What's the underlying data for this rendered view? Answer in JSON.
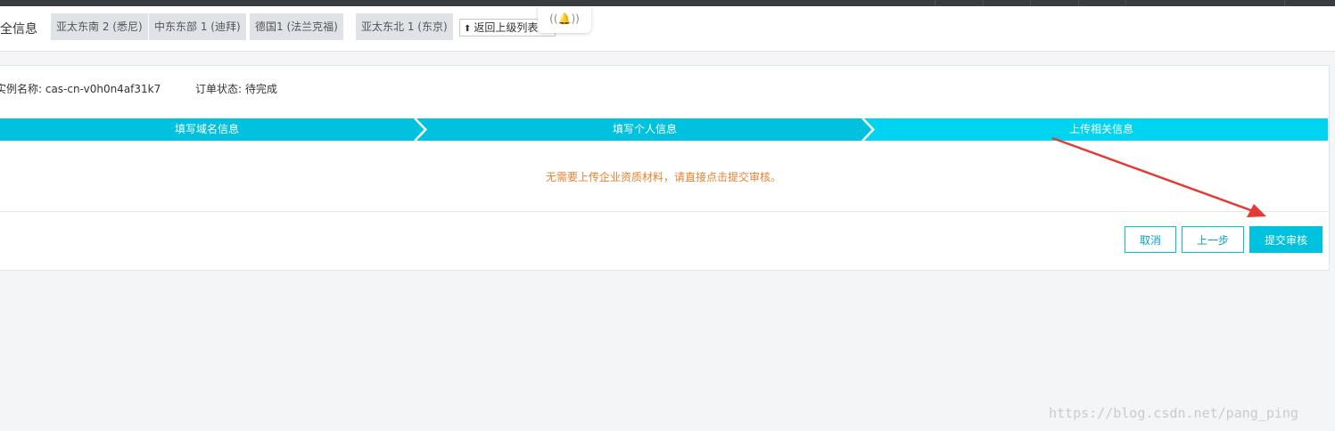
{
  "page_title": "全信息",
  "region_tabs": [
    {
      "label": "亚太东南 2 (悉尼)"
    },
    {
      "label": "中东东部 1 (迪拜)"
    },
    {
      "label": "德国1 (法兰克福)"
    },
    {
      "label": "亚太东北 1 (东京)"
    }
  ],
  "back_button": {
    "label": "返回上级列表"
  },
  "bell_widget": {
    "icon": "bell-icon"
  },
  "order": {
    "instance_label": "实例名称: cas-cn-v0h0n4af31k7",
    "status_label": "订单状态: 待完成"
  },
  "steps": [
    {
      "label": "填写域名信息",
      "active": false
    },
    {
      "label": "填写个人信息",
      "active": false
    },
    {
      "label": "上传相关信息",
      "active": true
    }
  ],
  "notice": "无需要上传企业资质材料，请直接点击提交审核。",
  "actions": {
    "cancel_label": "取消",
    "prev_label": "上一步",
    "submit_label": "提交审核"
  },
  "watermark": "https://blog.csdn.net/pang_ping",
  "colors": {
    "accent": "#00c1de",
    "step_done": "#00c1de",
    "step_active": "#00d4f0",
    "notice": "#e8832f",
    "annotation_arrow": "#e53935"
  }
}
